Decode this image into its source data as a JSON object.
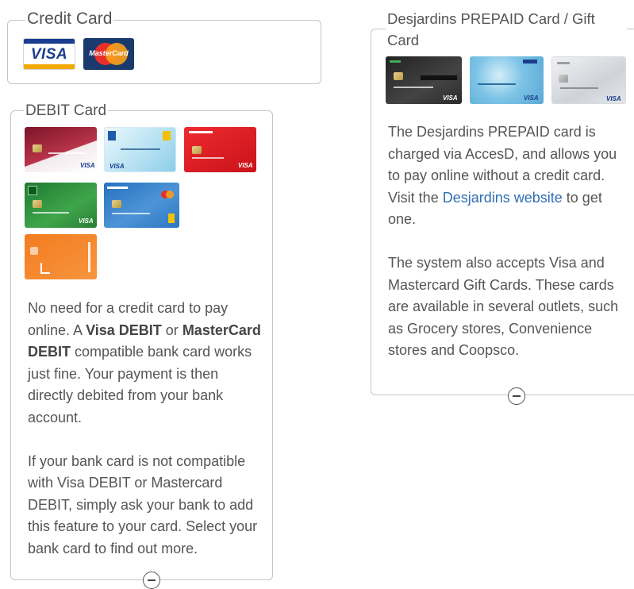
{
  "credit": {
    "legend": "Credit Card",
    "cards": [
      {
        "icon": "visa-logo-icon",
        "label": "VISA"
      },
      {
        "icon": "mastercard-logo-icon",
        "label": "MasterCard"
      }
    ]
  },
  "debit": {
    "legend": "DEBIT Card",
    "cards": [
      {
        "icon": "desjardins-debit-card-icon",
        "color": "#a8243a"
      },
      {
        "icon": "rbc-debit-card-icon",
        "color": "#bfe6f4"
      },
      {
        "icon": "scotiabank-debit-card-icon",
        "color": "#e01e24"
      },
      {
        "icon": "td-debit-card-icon",
        "color": "#2e8b3c"
      },
      {
        "icon": "bmo-debit-card-icon",
        "color": "#2f7cc8"
      },
      {
        "icon": "tangerine-debit-card-icon",
        "color": "#f58220"
      }
    ],
    "para1": {
      "t1": "No need for a credit card to pay online. A ",
      "b1": "Visa DEBIT",
      "t2": " or ",
      "b2": "MasterCard DEBIT",
      "t3": " compatible bank card works just fine. Your payment is then directly debited from your bank account."
    },
    "para2": "If your bank card is not compatible with Visa DEBIT or Mastercard DEBIT, simply ask your bank to add this feature to your card. Select your bank card to find out more."
  },
  "prepaid": {
    "legend": "Desjardins PREPAID Card / Gift Card",
    "cards": [
      {
        "icon": "desjardins-prepaid-black-card-icon",
        "color": "#333333"
      },
      {
        "icon": "desjardins-prepaid-blue-card-icon",
        "color": "#7cc3e6"
      },
      {
        "icon": "desjardins-prepaid-silver-card-icon",
        "color": "#d8dbdf"
      }
    ],
    "para1": {
      "t1": "The Desjardins PREPAID card is charged via AccesD, and allows you to pay online without a credit card. Visit the ",
      "link": "Desjardins website",
      "t2": " to get one."
    },
    "para2": "The system also accepts Visa and Mastercard Gift Cards. These cards are available in several outlets, such as Grocery stores, Convenience stores and Coopsco."
  }
}
